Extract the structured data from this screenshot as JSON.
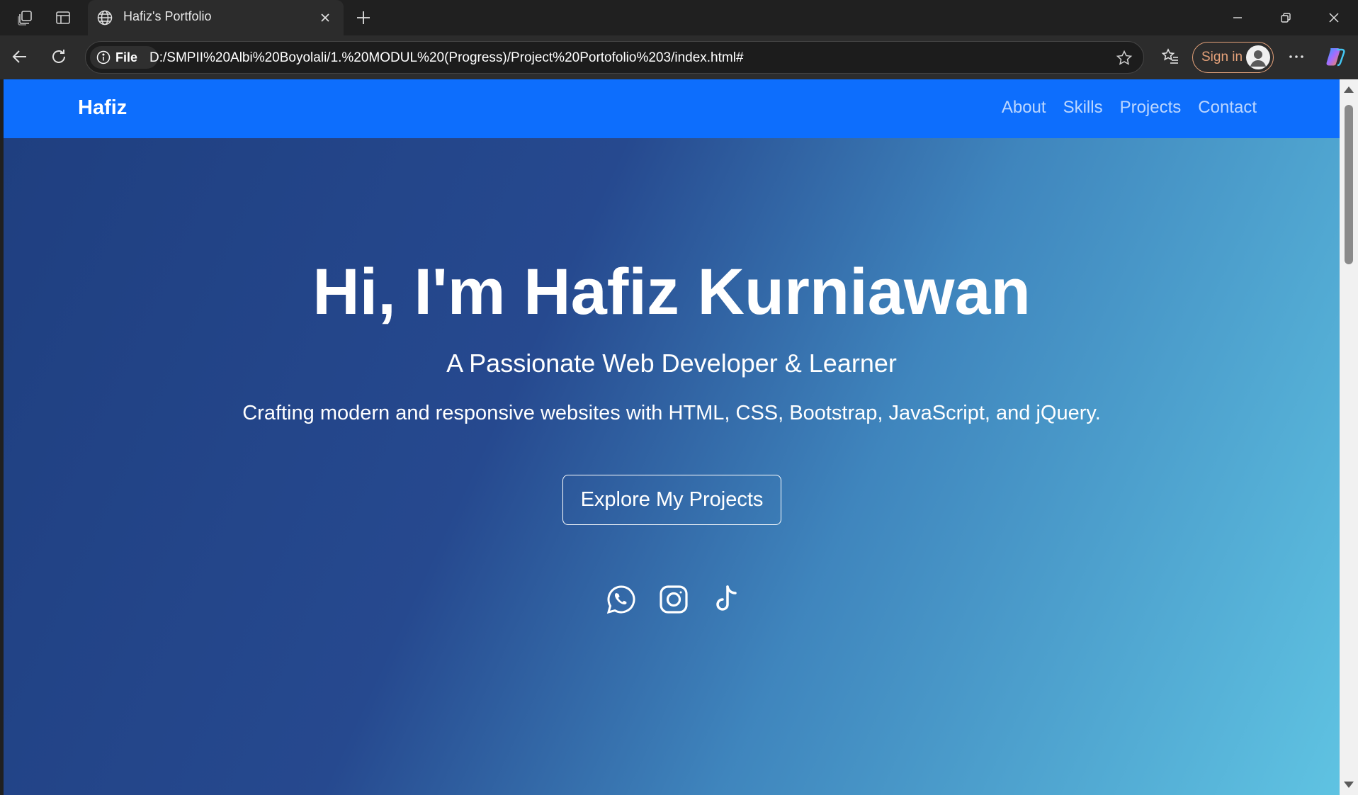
{
  "browser": {
    "tab": {
      "title": "Hafiz's Portfolio"
    },
    "address": {
      "chip_label": "File",
      "url": "D:/SMPII%20Albi%20Boyolali/1.%20MODUL%20(Progress)/Project%20Portofolio%203/index.html#"
    },
    "signin_label": "Sign in"
  },
  "page": {
    "nav": {
      "brand": "Hafiz",
      "links": [
        "About",
        "Skills",
        "Projects",
        "Contact"
      ]
    },
    "hero": {
      "title": "Hi, I'm Hafiz Kurniawan",
      "subtitle": "A Passionate Web Developer & Learner",
      "description": "Crafting modern and responsive websites with HTML, CSS, Bootstrap, JavaScript, and jQuery.",
      "cta_label": "Explore My Projects",
      "social_icons": [
        "whatsapp-icon",
        "instagram-icon",
        "tiktok-icon"
      ]
    },
    "colors": {
      "navbar": "#0d6efd",
      "hero_gradient_start": "#1f3f80",
      "hero_gradient_end": "#5fc3e2",
      "signin_accent": "#e5a27a"
    }
  }
}
